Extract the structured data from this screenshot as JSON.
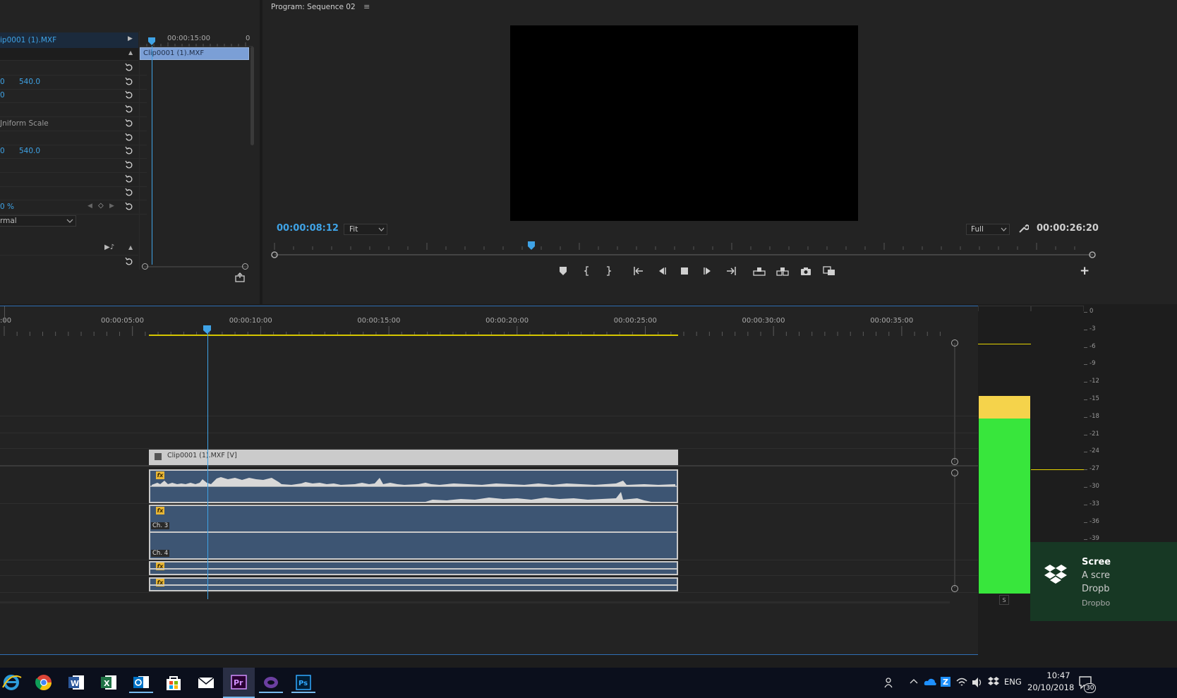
{
  "effect_controls": {
    "clip_name": "ip0001 (1).MXF",
    "mini_timeline_time": "00:00:15:00",
    "mini_timeline_cut": "0",
    "mini_clip_label": "Clip0001 (1).MXF",
    "rows": [
      {
        "prefix": "",
        "value": ""
      },
      {
        "prefix": "0",
        "value": "540.0"
      },
      {
        "prefix": "0",
        "value": ""
      },
      {
        "prefix": "",
        "value": ""
      },
      {
        "prefix": "Jniform Scale",
        "value": ""
      },
      {
        "prefix": "",
        "value": ""
      },
      {
        "prefix": "0",
        "value": "540.0"
      },
      {
        "prefix": "",
        "value": ""
      },
      {
        "prefix": "",
        "value": ""
      },
      {
        "prefix": "",
        "value": ""
      },
      {
        "prefix": "0 %",
        "value": ""
      },
      {
        "prefix": "rmal",
        "value": ""
      }
    ]
  },
  "program_monitor": {
    "title": "Program: Sequence 02",
    "current_time": "00:00:08:12",
    "zoom": "Fit",
    "resolution": "Full",
    "duration": "00:00:26:20"
  },
  "timeline": {
    "ruler": [
      ":00",
      "00:00:05:00",
      "00:00:10:00",
      "00:00:15:00",
      "00:00:20:00",
      "00:00:25:00",
      "00:00:30:00",
      "00:00:35:00"
    ],
    "video_clip_label": "Clip0001 (1).MXF [V]",
    "ch3_label": "Ch. 3",
    "ch4_label": "Ch. 4",
    "fx_label": "fx"
  },
  "audio_meter": {
    "scale": [
      "0",
      "-3",
      "-6",
      "-9",
      "-12",
      "-15",
      "-18",
      "-21",
      "-24",
      "-27",
      "-30",
      "-33",
      "-36",
      "-39"
    ],
    "solo": "S",
    "level_green": 0.62,
    "level_yellow": 0.08,
    "colors": {
      "green": "#38e63c",
      "yellow": "#f5d34b",
      "peak": "#e6d400"
    }
  },
  "notification": {
    "title": "Scree",
    "line1": "A scre",
    "line2": "Dropb",
    "source": "Dropbo"
  },
  "taskbar": {
    "apps": [
      "internet-explorer-icon",
      "chrome-icon",
      "word-icon",
      "excel-icon",
      "outlook-icon",
      "store-icon",
      "mail-icon",
      "premiere-icon",
      "cortana-icon",
      "photoshop-icon"
    ],
    "premiere_label": "Pr",
    "photoshop_label": "Ps",
    "word_label": "W",
    "excel_label": "X",
    "lang": "ENG",
    "time": "10:47",
    "date": "20/10/2018",
    "notification_count": "30"
  }
}
